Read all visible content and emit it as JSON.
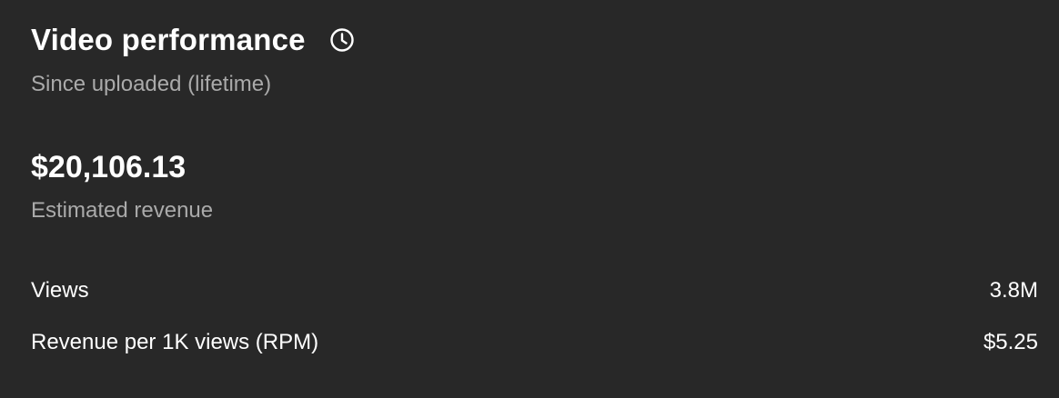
{
  "header": {
    "title": "Video performance",
    "subtitle": "Since uploaded (lifetime)",
    "icon": "clock-icon"
  },
  "revenue": {
    "value": "$20,106.13",
    "label": "Estimated revenue"
  },
  "metrics": [
    {
      "label": "Views",
      "value": "3.8M"
    },
    {
      "label": "Revenue per 1K views (RPM)",
      "value": "$5.25"
    }
  ],
  "colors": {
    "background": "#282828",
    "primary_text": "#ffffff",
    "secondary_text": "#aaaaaa"
  }
}
